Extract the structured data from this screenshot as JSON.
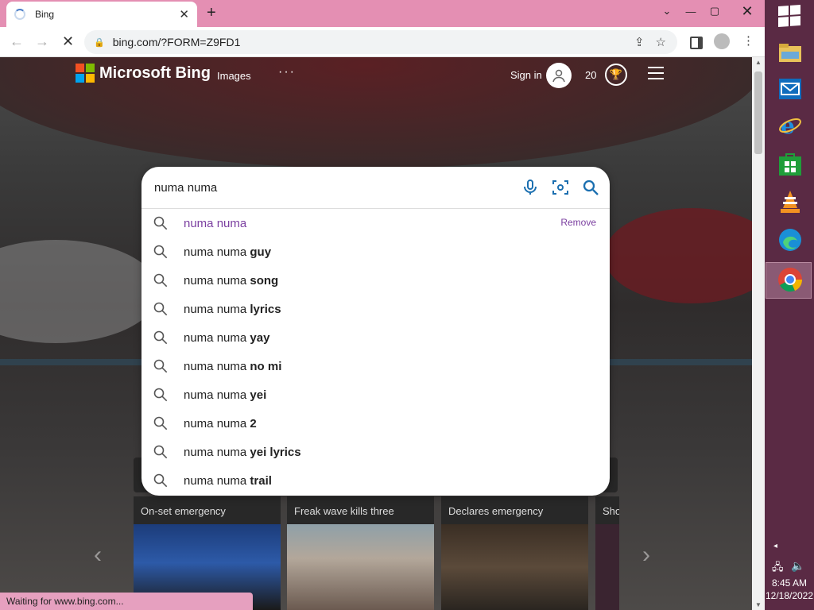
{
  "browser": {
    "tab_title": "Bing",
    "url": "bing.com/?FORM=Z9FD1",
    "window_controls": {
      "minimize": "⌄",
      "restore": "▢",
      "close": "✕"
    },
    "new_tab": "+"
  },
  "bing": {
    "brand": "Microsoft Bing",
    "nav_images": "Images",
    "more": "···",
    "sign_in": "Sign in",
    "points": "20"
  },
  "search": {
    "query": "numa numa",
    "suggestions": [
      {
        "prefix": "numa numa",
        "bold": "",
        "history": true,
        "remove": "Remove"
      },
      {
        "prefix": "numa numa ",
        "bold": "guy"
      },
      {
        "prefix": "numa numa ",
        "bold": "song"
      },
      {
        "prefix": "numa numa ",
        "bold": "lyrics"
      },
      {
        "prefix": "numa numa ",
        "bold": "yay"
      },
      {
        "prefix": "numa numa ",
        "bold": "no mi"
      },
      {
        "prefix": "numa numa ",
        "bold": "yei"
      },
      {
        "prefix": "numa numa ",
        "bold": "2"
      },
      {
        "prefix": "numa numa ",
        "bold": "yei lyrics"
      },
      {
        "prefix": "numa numa ",
        "bold": "trail"
      }
    ]
  },
  "news": {
    "tiles": [
      {
        "caption": "On-set emergency"
      },
      {
        "caption": "Freak wave kills three"
      },
      {
        "caption": "Declares emergency"
      },
      {
        "caption": "Sho"
      }
    ]
  },
  "status": {
    "text": "Waiting for www.bing.com..."
  },
  "taskbar": {
    "time": "8:45 AM",
    "date": "12/18/2022"
  },
  "colors": {
    "tabbar": "#e48fb3",
    "taskbar": "#5a2a44",
    "history_link": "#7b3fa0",
    "search_icon": "#1b6fb0"
  }
}
